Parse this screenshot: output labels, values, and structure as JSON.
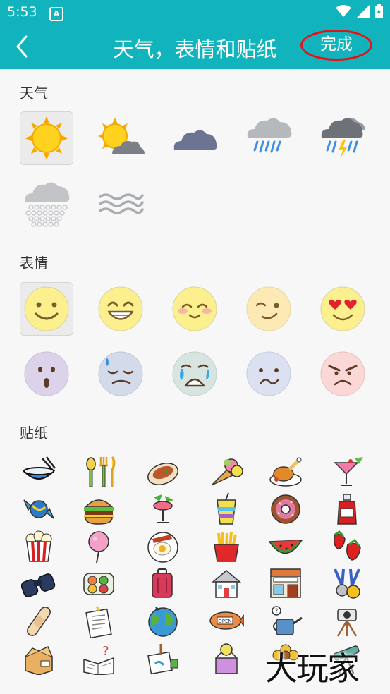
{
  "status": {
    "time": "5:53"
  },
  "header": {
    "title": "天气，表情和贴纸",
    "done_label": "完成"
  },
  "sections": {
    "weather": "天气",
    "emoji": "表情",
    "stickers": "贴纸"
  },
  "weather_icons": [
    "sunny-icon",
    "partly-cloudy-icon",
    "cloudy-icon",
    "rain-icon",
    "thunderstorm-icon",
    "snow-icon",
    "fog-icon"
  ],
  "emoji_icons": [
    "smile-icon",
    "grin-icon",
    "blush-icon",
    "wink-icon",
    "heart-eyes-icon",
    "surprised-icon",
    "sad-sweat-icon",
    "crying-icon",
    "confused-icon",
    "angry-icon"
  ],
  "sticker_icons": [
    "bowl-chopsticks",
    "fork-spoon",
    "roast-fish",
    "ice-cream",
    "roast-chicken",
    "cocktail",
    "candy",
    "burger",
    "tropical-drink",
    "smoothie",
    "donut",
    "ketchup",
    "popcorn",
    "cotton-candy",
    "fried-egg",
    "french-fries",
    "watermelon",
    "strawberries",
    "binoculars",
    "sushi",
    "suitcase",
    "house",
    "restaurant",
    "medals",
    "bandage",
    "notebook",
    "globe",
    "blimp",
    "watering-can",
    "camera-tripod",
    "open-box",
    "question-book",
    "paint-canvas",
    "lightbulb-box",
    "flower",
    "telescope"
  ],
  "watermark": "大玩家",
  "colors": {
    "accent": "#11b4bd",
    "highlight": "#e0151b"
  }
}
